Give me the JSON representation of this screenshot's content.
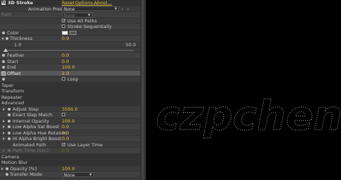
{
  "effect": {
    "name": "3D Stroke",
    "reset": "Reset",
    "options": "Options...",
    "about": "About..."
  },
  "presets": {
    "label": "Animation Presets:",
    "value": "None"
  },
  "path": {
    "label": "Path",
    "value": "None"
  },
  "use_all_paths": "Use All Paths",
  "stroke_sequentially": "Stroke Sequentially",
  "color": {
    "label": "Color",
    "value": "#ffffff"
  },
  "thickness": {
    "label": "Thickness",
    "value": "0.9",
    "min": "1.0",
    "max": "50.0",
    "level": 0.0
  },
  "feather": {
    "label": "Feather",
    "value": "0.0"
  },
  "start": {
    "label": "Start",
    "value": "0.0"
  },
  "end": {
    "label": "End",
    "value": "100.0"
  },
  "offset": {
    "label": "Offset",
    "value": "2.0"
  },
  "loop": "Loop",
  "sections": {
    "taper": "Taper",
    "transform": "Transform",
    "repeater": "Repeater",
    "advanced": "Advanced",
    "camera": "Camera",
    "motion_blur": "Motion Blur"
  },
  "advanced": {
    "adjust_step": {
      "label": "Adjust Step",
      "value": "3500.0"
    },
    "exact_step_match": "Exact Step Match",
    "internal_opacity": {
      "label": "Internal Opacity",
      "value": "100.0"
    },
    "low_alpha_sat_boost": {
      "label": "Low Alpha Sat Boost",
      "value": "0.0"
    },
    "low_alpha_hue_rotation": {
      "label": "Low Alpha Hue Rotation",
      "value": "0.0"
    },
    "hi_alpha_bright_boost": {
      "label": "Hi Alpha Bright Boost",
      "value": "0.0"
    },
    "animated_path": "Animated Path",
    "use_layer_time": "Use Layer Time",
    "path_time": {
      "label": "Path Time (Sec)",
      "value": "0.0"
    }
  },
  "opacity": {
    "label": "Opacity [%]",
    "value": "100.0"
  },
  "transfer_mode": {
    "label": "Transfer Mode",
    "value": "None"
  },
  "preview_text": "czpcheng"
}
